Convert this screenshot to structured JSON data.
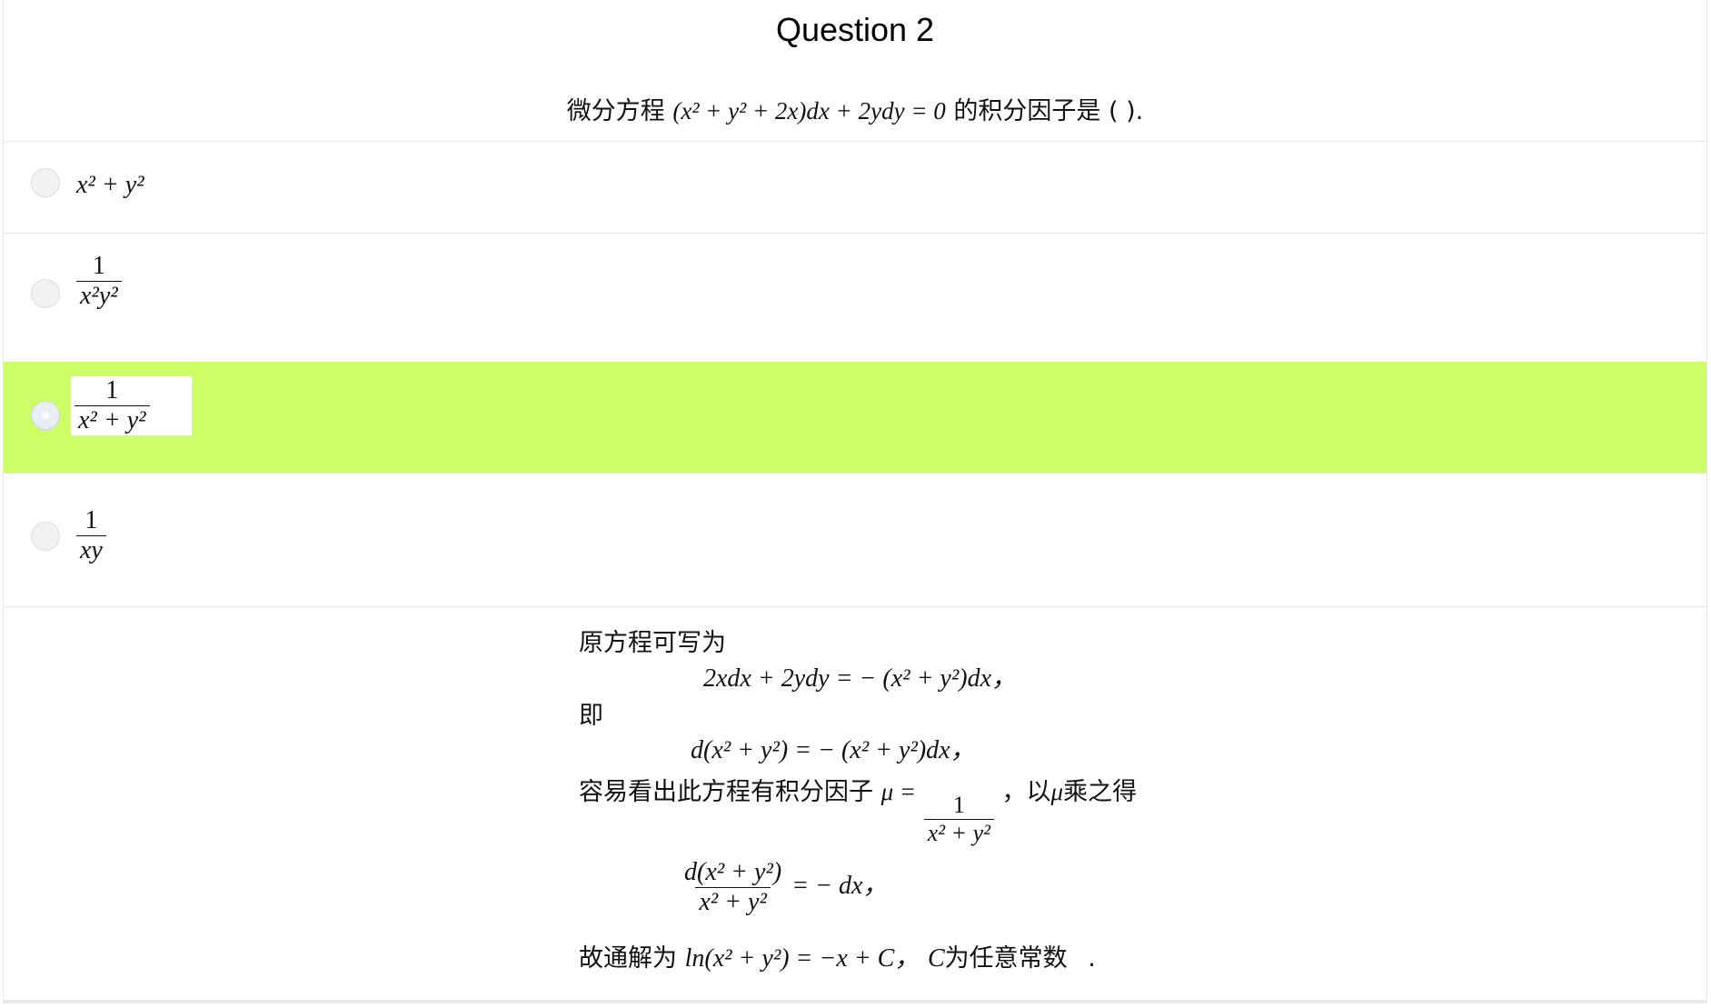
{
  "question": {
    "title": "Question 2",
    "stem_prefix": "微分方程",
    "stem_equation": "(x² + y² + 2x)dx + 2ydy = 0",
    "stem_suffix": "的积分因子是 ( )."
  },
  "options": [
    {
      "label": "x² + y²",
      "numerator": "",
      "denominator": "",
      "selected": false
    },
    {
      "label": "",
      "numerator": "1",
      "denominator": "x²y²",
      "selected": false
    },
    {
      "label": "",
      "numerator": "1",
      "denominator": "x² + y²",
      "selected": true
    },
    {
      "label": "",
      "numerator": "1",
      "denominator": "xy",
      "selected": false
    }
  ],
  "solution": {
    "line1": "原方程可写为",
    "eq1": "2xdx + 2ydy = − (x² + y²)dx，",
    "line2": "即",
    "eq2": "d(x² + y²) = − (x² + y²)dx，",
    "line3_prefix": "容易看出此方程有积分因子",
    "mu_symbol": "μ =",
    "mu_numerator": "1",
    "mu_denominator": "x² + y²",
    "line3_mid": "，以",
    "mu_inline": "μ",
    "line3_suffix": "乘之得",
    "eq3_numerator": "d(x² + y²)",
    "eq3_denominator": "x² + y²",
    "eq3_rhs": "= − dx，",
    "line4_prefix": "故通解为",
    "eq4": "ln(x² + y²) = −x + C，",
    "line4_c": "C",
    "line4_suffix": "为任意常数",
    "line4_end": "."
  },
  "colors": {
    "selected_background": "#ccff66",
    "radio_fill": "#f2f2f2"
  }
}
